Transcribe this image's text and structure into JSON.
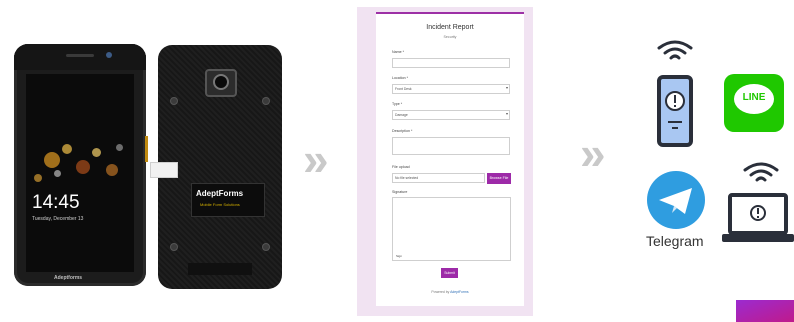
{
  "phone": {
    "clock": "14:45",
    "date": "Tuesday, December 13",
    "brand": "Adeptforms",
    "back_label": "AdeptForms",
    "back_label_sub": "Mobile Form Solutions"
  },
  "form": {
    "title": "Incident Report",
    "subtitle": "Security",
    "fields": [
      {
        "label": "Name *",
        "value": ""
      },
      {
        "label": "Location *",
        "value": "Front Desk"
      },
      {
        "label": "Type *",
        "value": "Damage"
      },
      {
        "label": "Description *",
        "value": ""
      }
    ],
    "file_upload_label": "File upload",
    "file_placeholder": "No file selected",
    "browse_label": "Browse File",
    "signature_label": "Signature",
    "signature_hint": "Sign",
    "submit_label": "Submit",
    "powered_prefix": "Powered by",
    "powered_link": "AdeptForms"
  },
  "destinations": {
    "line_label": "LINE",
    "telegram_label": "Telegram"
  },
  "chevrons": {
    "glyph": "»"
  },
  "colors": {
    "accent": "#9d2aa8",
    "line": "#1fc800",
    "telegram": "#2f9de0"
  }
}
